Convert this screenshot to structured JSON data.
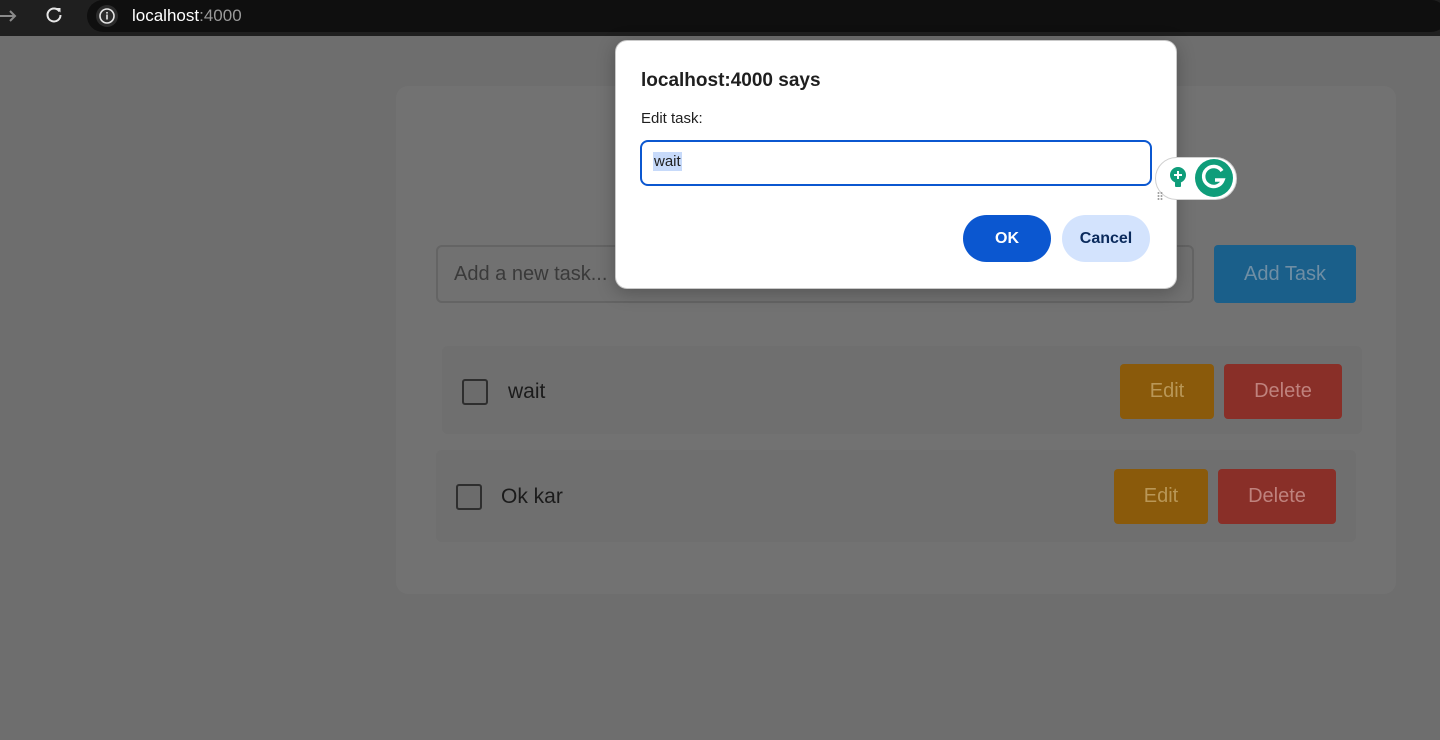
{
  "browser": {
    "url_host": "localhost",
    "url_port": ":4000",
    "icons": [
      "forward-arrow-icon",
      "reload-icon",
      "site-info-icon"
    ]
  },
  "page": {
    "task_input": {
      "placeholder": "Add a new task...",
      "value": ""
    },
    "add_button_label": "Add Task",
    "tasks": [
      {
        "label": "wait",
        "checked": false,
        "edit_label": "Edit",
        "delete_label": "Delete"
      },
      {
        "label": "Ok kar",
        "checked": false,
        "edit_label": "Edit",
        "delete_label": "Delete"
      }
    ]
  },
  "dialog": {
    "title": "localhost:4000 says",
    "message": "Edit task:",
    "input_value": "wait",
    "ok_label": "OK",
    "cancel_label": "Cancel"
  },
  "colors": {
    "accent_blue": "#0b57d0",
    "cancel_bg": "#d3e3fd",
    "grammarly_green": "#15c39a"
  }
}
